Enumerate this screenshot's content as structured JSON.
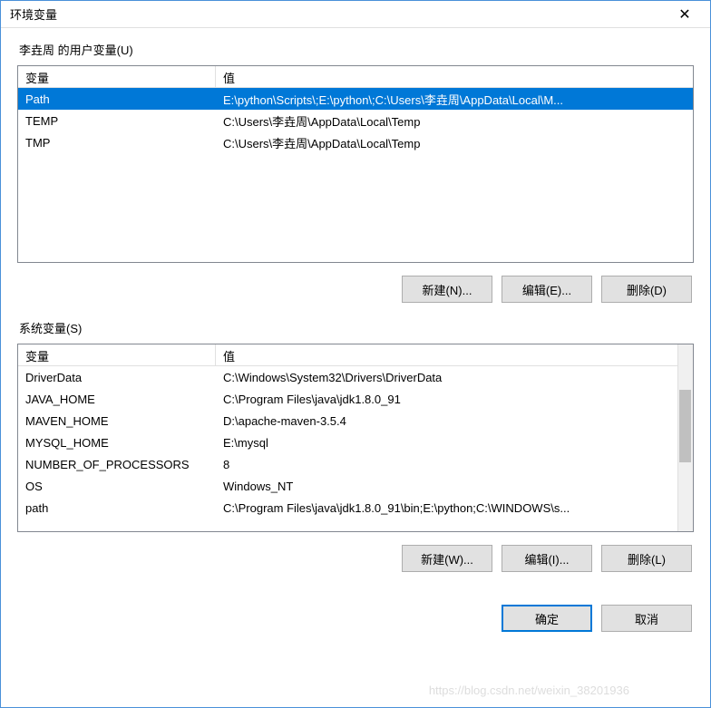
{
  "window": {
    "title": "环境变量"
  },
  "user_section": {
    "label": "李垚周 的用户变量(U)",
    "header_var": "变量",
    "header_val": "值",
    "rows": [
      {
        "var": "Path",
        "val": "E:\\python\\Scripts\\;E:\\python\\;C:\\Users\\李垚周\\AppData\\Local\\M...",
        "selected": true
      },
      {
        "var": "TEMP",
        "val": "C:\\Users\\李垚周\\AppData\\Local\\Temp",
        "selected": false
      },
      {
        "var": "TMP",
        "val": "C:\\Users\\李垚周\\AppData\\Local\\Temp",
        "selected": false
      }
    ],
    "buttons": {
      "new": "新建(N)...",
      "edit": "编辑(E)...",
      "delete": "删除(D)"
    }
  },
  "system_section": {
    "label": "系统变量(S)",
    "header_var": "变量",
    "header_val": "值",
    "rows": [
      {
        "var": "DriverData",
        "val": "C:\\Windows\\System32\\Drivers\\DriverData"
      },
      {
        "var": "JAVA_HOME",
        "val": "C:\\Program Files\\java\\jdk1.8.0_91"
      },
      {
        "var": "MAVEN_HOME",
        "val": "D:\\apache-maven-3.5.4"
      },
      {
        "var": "MYSQL_HOME",
        "val": "E:\\mysql"
      },
      {
        "var": "NUMBER_OF_PROCESSORS",
        "val": "8"
      },
      {
        "var": "OS",
        "val": "Windows_NT"
      },
      {
        "var": "path",
        "val": "C:\\Program Files\\java\\jdk1.8.0_91\\bin;E:\\python;C:\\WINDOWS\\s..."
      }
    ],
    "buttons": {
      "new": "新建(W)...",
      "edit": "编辑(I)...",
      "delete": "删除(L)"
    }
  },
  "dialog_buttons": {
    "ok": "确定",
    "cancel": "取消"
  },
  "watermark": "https://blog.csdn.net/weixin_38201936"
}
